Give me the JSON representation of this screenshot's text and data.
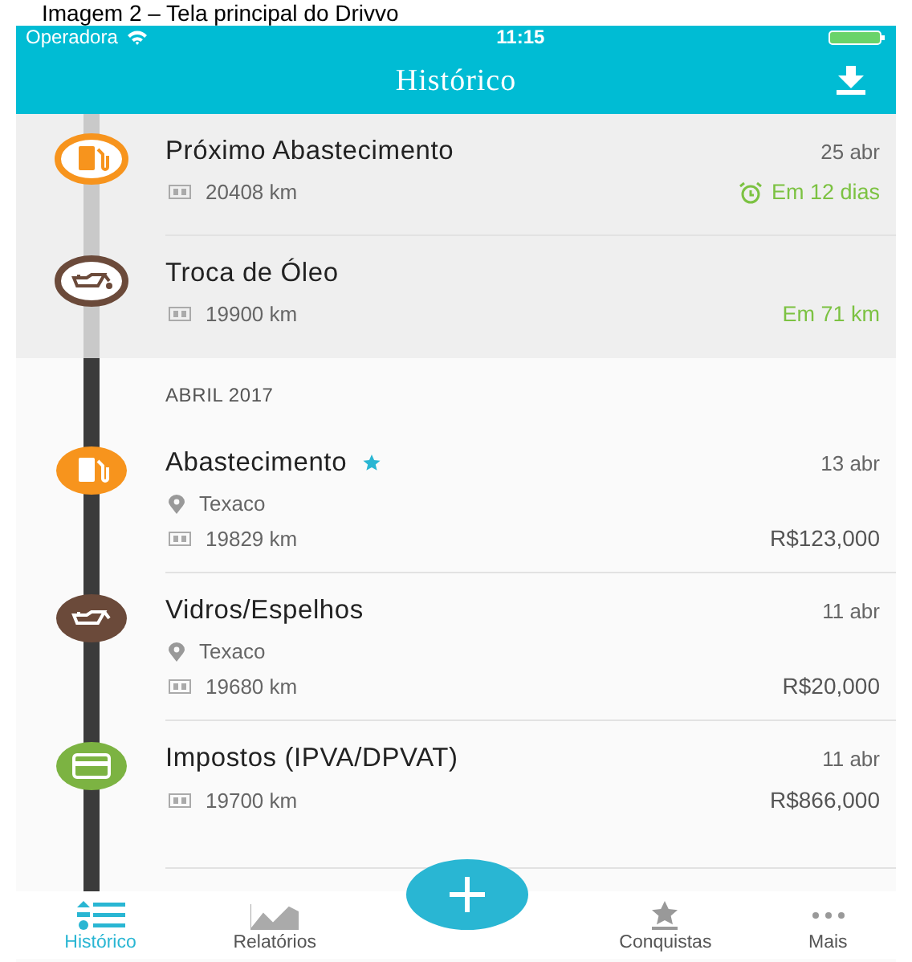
{
  "caption": "Imagem 2 – Tela principal do Drivvo",
  "status_bar": {
    "carrier": "Operadora",
    "time": "11:15"
  },
  "header": {
    "title": "Histórico"
  },
  "upcoming": [
    {
      "kind": "fuel",
      "title": "Próximo Abastecimento",
      "date": "25 abr",
      "odometer": "20408 km",
      "due": "Em 12 dias",
      "alarm": true,
      "color": "#f7941d"
    },
    {
      "kind": "oil",
      "title": "Troca de Óleo",
      "odometer": "19900 km",
      "due": "Em 71 km",
      "alarm": false,
      "color": "#6b4a3a"
    }
  ],
  "month": "ABRIL 2017",
  "entries": [
    {
      "kind": "fuel",
      "title": "Abastecimento",
      "starred": true,
      "date": "13 abr",
      "location": "Texaco",
      "odometer": "19829 km",
      "amount": "R$123,000",
      "color": "#f7941d"
    },
    {
      "kind": "oil",
      "title": "Vidros/Espelhos",
      "starred": false,
      "date": "11 abr",
      "location": "Texaco",
      "odometer": "19680 km",
      "amount": "R$20,000",
      "color": "#6b4a3a"
    },
    {
      "kind": "tax",
      "title": "Impostos (IPVA/DPVAT)",
      "starred": false,
      "date": "11 abr",
      "odometer": "19700 km",
      "amount": "R$866,000",
      "color": "#7cb342"
    }
  ],
  "nav": [
    {
      "kind": "list",
      "label": "Histórico",
      "selected": true
    },
    {
      "kind": "chart",
      "label": "Relatórios",
      "selected": false
    },
    {
      "kind": "add"
    },
    {
      "kind": "star",
      "label": "Conquistas",
      "selected": false
    },
    {
      "kind": "more",
      "label": "Mais",
      "selected": false
    }
  ]
}
